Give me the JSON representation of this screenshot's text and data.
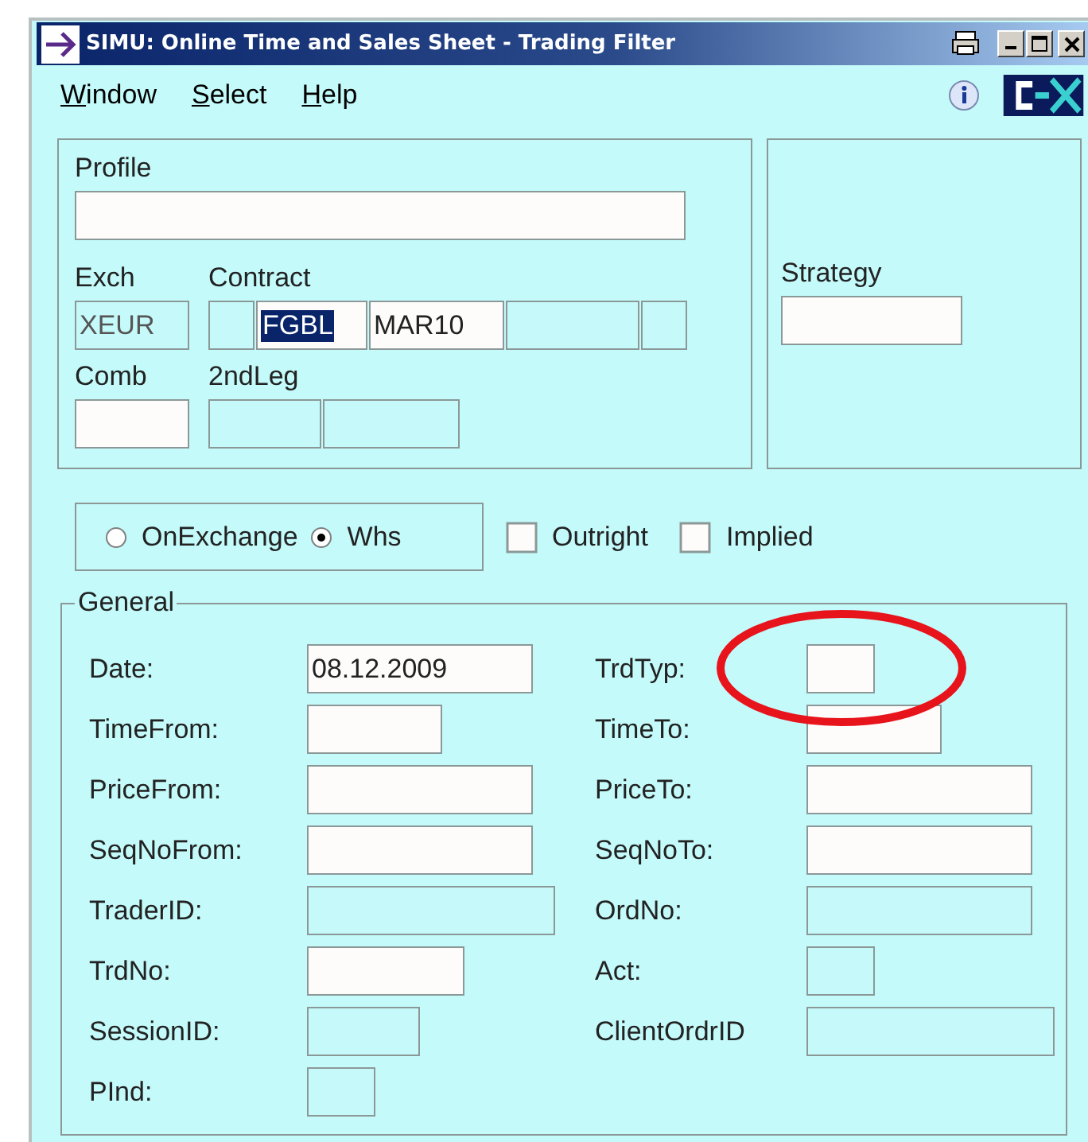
{
  "window": {
    "title": "SIMU: Online Time and Sales Sheet - Trading Filter"
  },
  "menu": [
    {
      "label": "Window"
    },
    {
      "label": "Select"
    },
    {
      "label": "Help"
    }
  ],
  "profile": {
    "label": "Profile",
    "field": {
      "disabled": false
    }
  },
  "exch": {
    "label": "Exch",
    "field": {
      "value": "XEUR",
      "disabled": true
    }
  },
  "contract": {
    "label": "Contract",
    "segments": [
      {
        "disabled": true
      },
      {
        "value": "FGBL",
        "disabled": false,
        "selected": true
      },
      {
        "value": "MAR10",
        "disabled": false,
        "selected": false
      },
      {
        "disabled": true
      },
      {
        "disabled": true
      }
    ]
  },
  "comb": {
    "label": "Comb",
    "field": {
      "disabled": false
    }
  },
  "second_leg": {
    "label": "2ndLeg",
    "segments": [
      {
        "disabled": true
      },
      {
        "disabled": true
      }
    ]
  },
  "strategy": {
    "label": "Strategy",
    "field": {
      "disabled": false
    }
  },
  "source": [
    {
      "label": "OnExchange",
      "selected": false
    },
    {
      "label": "Whs",
      "selected": true
    }
  ],
  "options": [
    {
      "label": "Outright",
      "checked": false
    },
    {
      "label": "Implied",
      "checked": false
    }
  ],
  "general": {
    "title": "General",
    "fields": [
      {
        "label": "Date:",
        "value": "08.12.2009",
        "disabled": false
      },
      {
        "label": "TrdTyp:",
        "disabled": false
      },
      {
        "label": "TimeFrom:",
        "disabled": false
      },
      {
        "label": "TimeTo:",
        "disabled": false
      },
      {
        "label": "PriceFrom:",
        "disabled": false
      },
      {
        "label": "PriceTo:",
        "disabled": false
      },
      {
        "label": "SeqNoFrom:",
        "disabled": false
      },
      {
        "label": "SeqNoTo:",
        "disabled": false
      },
      {
        "label": "TraderID:",
        "disabled": true
      },
      {
        "label": "OrdNo:",
        "disabled": true
      },
      {
        "label": "TrdNo:",
        "disabled": false
      },
      {
        "label": "Act:",
        "disabled": true
      },
      {
        "label": "SessionID:",
        "disabled": true
      },
      {
        "label": "ClientOrdrID",
        "disabled": true
      },
      {
        "label": "PInd:",
        "disabled": true
      }
    ]
  }
}
